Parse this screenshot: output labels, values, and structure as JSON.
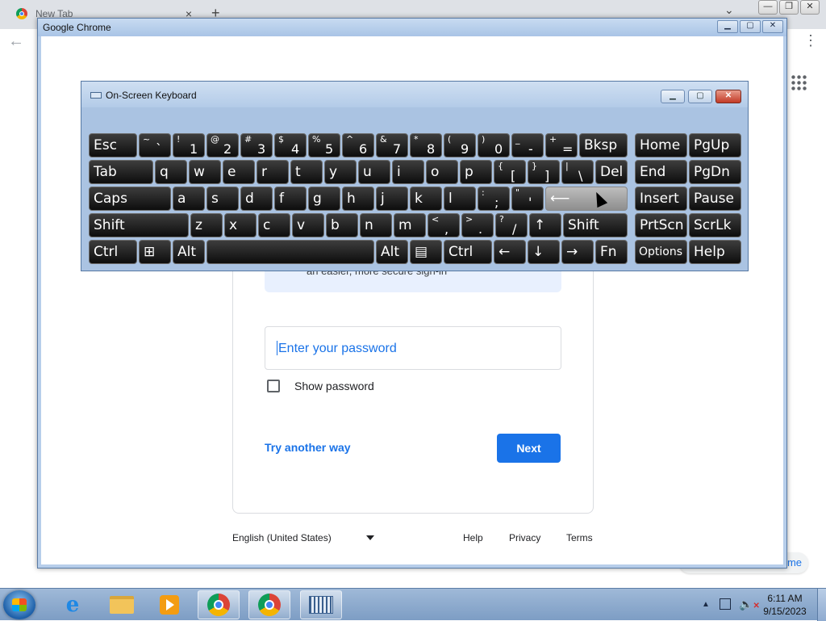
{
  "background_browser": {
    "tab_title": "New Tab",
    "tab_close": "×",
    "new_tab": "+",
    "right_link": "me"
  },
  "chrome_window": {
    "title": "Google Chrome"
  },
  "signin": {
    "info_text": "an easier, more secure sign-in",
    "password_placeholder": "Enter your password",
    "show_password": "Show password",
    "try_another_way": "Try another way",
    "next": "Next",
    "footer": {
      "language": "English (United States)",
      "help": "Help",
      "privacy": "Privacy",
      "terms": "Terms"
    }
  },
  "osk": {
    "title": "On-Screen Keyboard",
    "rows": [
      [
        [
          "Esc"
        ],
        [
          "~",
          "`"
        ],
        [
          "!",
          "1"
        ],
        [
          "@",
          "2"
        ],
        [
          "#",
          "3"
        ],
        [
          "$",
          "4"
        ],
        [
          "%",
          "5"
        ],
        [
          "^",
          "6"
        ],
        [
          "&",
          "7"
        ],
        [
          "*",
          "8"
        ],
        [
          "(",
          "9"
        ],
        [
          ")",
          "0"
        ],
        [
          "_",
          "-"
        ],
        [
          "+",
          "="
        ],
        [
          "Bksp"
        ],
        [
          "Home"
        ],
        [
          "PgUp"
        ]
      ],
      [
        [
          "Tab"
        ],
        [
          "q"
        ],
        [
          "w"
        ],
        [
          "e"
        ],
        [
          "r"
        ],
        [
          "t"
        ],
        [
          "y"
        ],
        [
          "u"
        ],
        [
          "i"
        ],
        [
          "o"
        ],
        [
          "p"
        ],
        [
          "{",
          "["
        ],
        [
          "}",
          "]"
        ],
        [
          "|",
          "\\"
        ],
        [
          "Del"
        ],
        [
          "End"
        ],
        [
          "PgDn"
        ]
      ],
      [
        [
          "Caps"
        ],
        [
          "a"
        ],
        [
          "s"
        ],
        [
          "d"
        ],
        [
          "f"
        ],
        [
          "g"
        ],
        [
          "h"
        ],
        [
          "j"
        ],
        [
          "k"
        ],
        [
          "l"
        ],
        [
          ":",
          ";"
        ],
        [
          "\"",
          "'"
        ],
        [
          "⟵"
        ],
        [
          "Insert"
        ],
        [
          "Pause"
        ]
      ],
      [
        [
          "Shift"
        ],
        [
          "z"
        ],
        [
          "x"
        ],
        [
          "c"
        ],
        [
          "v"
        ],
        [
          "b"
        ],
        [
          "n"
        ],
        [
          "m"
        ],
        [
          "<",
          ","
        ],
        [
          ">",
          "."
        ],
        [
          "?",
          "/"
        ],
        [
          "↑"
        ],
        [
          "Shift"
        ],
        [
          "PrtScn"
        ],
        [
          "ScrLk"
        ]
      ],
      [
        [
          "Ctrl"
        ],
        [
          "⊞"
        ],
        [
          "Alt"
        ],
        [
          ""
        ],
        [
          "Alt"
        ],
        [
          "▤"
        ],
        [
          "Ctrl"
        ],
        [
          "←"
        ],
        [
          "↓"
        ],
        [
          "→"
        ],
        [
          "Fn"
        ],
        [
          "Options"
        ],
        [
          "Help"
        ]
      ]
    ]
  },
  "taskbar": {
    "items": [
      "internet-explorer",
      "file-explorer",
      "media-player",
      "chrome-profile",
      "chrome",
      "on-screen-keyboard"
    ],
    "time": "6:11 AM",
    "date": "9/15/2023"
  }
}
